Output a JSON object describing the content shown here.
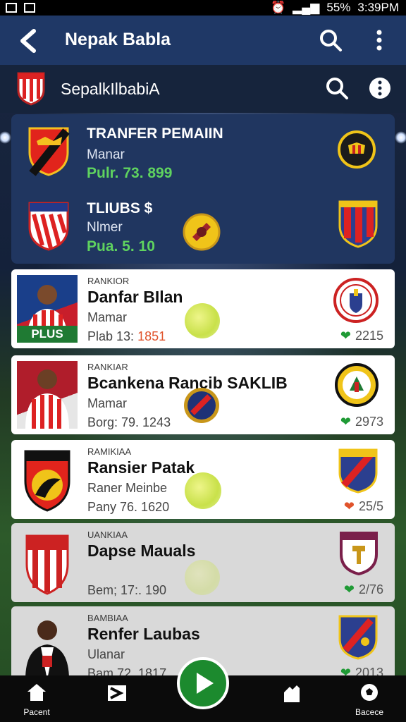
{
  "status_bar": {
    "battery": "55%",
    "time": "3:39PM"
  },
  "app_bar": {
    "title": "Nepak Babla"
  },
  "sub_bar": {
    "title": "SepalkIlbabiA"
  },
  "transfer_panel": {
    "rows": [
      {
        "title": "TRANFER PEMAIIN",
        "subtitle": "Manar",
        "value": "Pulr. 73. 899"
      },
      {
        "title": "TLIUBS $",
        "subtitle": "Nlmer",
        "value": "Pua. 5. 10"
      }
    ]
  },
  "cards": [
    {
      "rank": "RANKIOR",
      "name": "Danfar BIlan",
      "subtitle": "Mamar",
      "stat_prefix": "Plab 13:",
      "stat_highlight": "1851",
      "score": "2215",
      "thumb_label": "PLUS",
      "score_icon": "heart-icon-green"
    },
    {
      "rank": "RANKIAR",
      "name": "Bcankena Rancib SAKLIB",
      "subtitle": "Mamar",
      "stat_prefix": "Borg: 79. 1243",
      "stat_highlight": "",
      "score": "2973",
      "score_icon": "heart-icon-green"
    },
    {
      "rank": "RAMIKIAA",
      "name": "Ransier Patak",
      "subtitle": "Raner Meinbe",
      "stat_prefix": "Pany 76. 1620",
      "stat_highlight": "",
      "score": "25/5",
      "score_icon": "heart-icon-orange"
    },
    {
      "rank": "UANKIAA",
      "name": "Dapse Mauals",
      "subtitle": "",
      "stat_prefix": "Bem; 17:. 190",
      "stat_highlight": "",
      "score": "2/76",
      "score_icon": "heart-icon-green"
    },
    {
      "rank": "BAMBIAA",
      "name": "Renfer Laubas",
      "subtitle": "Ulanar",
      "stat_prefix": "Bam 72. 1817",
      "stat_highlight": "",
      "score": "2013",
      "score_icon": "heart-icon-green"
    }
  ],
  "bottom_nav": {
    "items": [
      {
        "label": "Pacent",
        "icon": "home-icon"
      },
      {
        "label": "",
        "icon": "swap-icon"
      },
      {
        "label": "",
        "icon": "play-icon"
      },
      {
        "label": "",
        "icon": "hand-icon"
      },
      {
        "label": "Bacece",
        "icon": "ball-icon"
      }
    ]
  },
  "colors": {
    "app_bar": "#1f3866",
    "panel": "#203660",
    "accent_green": "#5fd35f",
    "fab": "#1c8a2e",
    "highlight": "#e0532b"
  }
}
